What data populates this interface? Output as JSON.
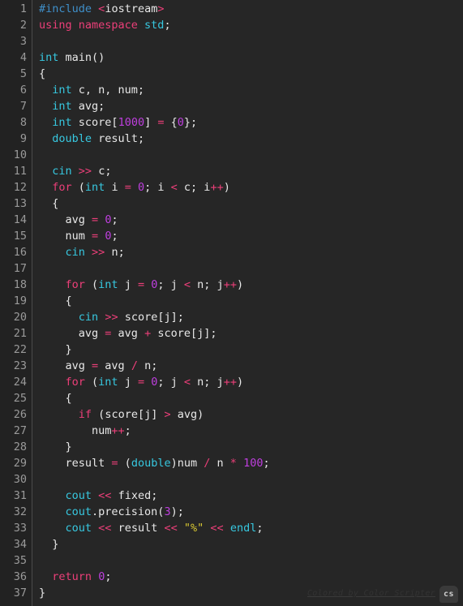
{
  "editor": {
    "theme_name": "dark",
    "language": "cpp",
    "total_lines": 37,
    "colors": {
      "background": "#262626",
      "gutter_background": "#222222",
      "gutter_border": "#4a4a4a",
      "line_number": "#9a9a9a",
      "default_text": "#e8e8e8",
      "preprocessor": "#3f8fc9",
      "keyword": "#ec3f79",
      "type": "#37c8e0",
      "number": "#bf3fdf",
      "operator": "#ec3f79",
      "string": "#d8c832"
    }
  },
  "line_numbers": [
    "1",
    "2",
    "3",
    "4",
    "5",
    "6",
    "7",
    "8",
    "9",
    "10",
    "11",
    "12",
    "13",
    "14",
    "15",
    "16",
    "17",
    "18",
    "19",
    "20",
    "21",
    "22",
    "23",
    "24",
    "25",
    "26",
    "27",
    "28",
    "29",
    "30",
    "31",
    "32",
    "33",
    "34",
    "35",
    "36",
    "37"
  ],
  "code_lines": [
    {
      "n": 1,
      "text": "#include <iostream>",
      "tokens": [
        {
          "t": "pre",
          "v": "#include"
        },
        {
          "t": "id",
          "v": " "
        },
        {
          "t": "op",
          "v": "<"
        },
        {
          "t": "id",
          "v": "iostream"
        },
        {
          "t": "op",
          "v": ">"
        }
      ]
    },
    {
      "n": 2,
      "text": "using namespace std;",
      "tokens": [
        {
          "t": "kw",
          "v": "using namespace "
        },
        {
          "t": "type",
          "v": "std"
        },
        {
          "t": "punc",
          "v": ";"
        }
      ]
    },
    {
      "n": 3,
      "text": "",
      "tokens": []
    },
    {
      "n": 4,
      "text": "int main()",
      "tokens": [
        {
          "t": "type",
          "v": "int"
        },
        {
          "t": "id",
          "v": " main()"
        }
      ]
    },
    {
      "n": 5,
      "text": "{",
      "tokens": [
        {
          "t": "punc",
          "v": "{"
        }
      ]
    },
    {
      "n": 6,
      "text": "  int c, n, num;",
      "tokens": [
        {
          "t": "id",
          "v": "  "
        },
        {
          "t": "type",
          "v": "int"
        },
        {
          "t": "id",
          "v": " c, n, num;"
        }
      ]
    },
    {
      "n": 7,
      "text": "  int avg;",
      "tokens": [
        {
          "t": "id",
          "v": "  "
        },
        {
          "t": "type",
          "v": "int"
        },
        {
          "t": "id",
          "v": " avg;"
        }
      ]
    },
    {
      "n": 8,
      "text": "  int score[1000] = {0};",
      "tokens": [
        {
          "t": "id",
          "v": "  "
        },
        {
          "t": "type",
          "v": "int"
        },
        {
          "t": "id",
          "v": " score["
        },
        {
          "t": "num",
          "v": "1000"
        },
        {
          "t": "punc",
          "v": "] "
        },
        {
          "t": "op",
          "v": "="
        },
        {
          "t": "punc",
          "v": " {"
        },
        {
          "t": "num",
          "v": "0"
        },
        {
          "t": "punc",
          "v": "};"
        }
      ]
    },
    {
      "n": 9,
      "text": "  double result;",
      "tokens": [
        {
          "t": "id",
          "v": "  "
        },
        {
          "t": "type",
          "v": "double"
        },
        {
          "t": "id",
          "v": " result;"
        }
      ]
    },
    {
      "n": 10,
      "text": "",
      "tokens": []
    },
    {
      "n": 11,
      "text": "  cin >> c;",
      "tokens": [
        {
          "t": "id",
          "v": "  "
        },
        {
          "t": "type",
          "v": "cin"
        },
        {
          "t": "id",
          "v": " "
        },
        {
          "t": "op",
          "v": ">>"
        },
        {
          "t": "id",
          "v": " c;"
        }
      ]
    },
    {
      "n": 12,
      "text": "  for (int i = 0; i < c; i++)",
      "tokens": [
        {
          "t": "id",
          "v": "  "
        },
        {
          "t": "kw",
          "v": "for"
        },
        {
          "t": "punc",
          "v": " ("
        },
        {
          "t": "type",
          "v": "int"
        },
        {
          "t": "id",
          "v": " i "
        },
        {
          "t": "op",
          "v": "="
        },
        {
          "t": "id",
          "v": " "
        },
        {
          "t": "num",
          "v": "0"
        },
        {
          "t": "punc",
          "v": "; "
        },
        {
          "t": "id",
          "v": "i "
        },
        {
          "t": "op",
          "v": "<"
        },
        {
          "t": "id",
          "v": " c; i"
        },
        {
          "t": "op",
          "v": "++"
        },
        {
          "t": "punc",
          "v": ")"
        }
      ]
    },
    {
      "n": 13,
      "text": "  {",
      "tokens": [
        {
          "t": "punc",
          "v": "  {"
        }
      ]
    },
    {
      "n": 14,
      "text": "    avg = 0;",
      "tokens": [
        {
          "t": "id",
          "v": "    avg "
        },
        {
          "t": "op",
          "v": "="
        },
        {
          "t": "id",
          "v": " "
        },
        {
          "t": "num",
          "v": "0"
        },
        {
          "t": "punc",
          "v": ";"
        }
      ]
    },
    {
      "n": 15,
      "text": "    num = 0;",
      "tokens": [
        {
          "t": "id",
          "v": "    num "
        },
        {
          "t": "op",
          "v": "="
        },
        {
          "t": "id",
          "v": " "
        },
        {
          "t": "num",
          "v": "0"
        },
        {
          "t": "punc",
          "v": ";"
        }
      ]
    },
    {
      "n": 16,
      "text": "    cin >> n;",
      "tokens": [
        {
          "t": "id",
          "v": "    "
        },
        {
          "t": "type",
          "v": "cin"
        },
        {
          "t": "id",
          "v": " "
        },
        {
          "t": "op",
          "v": ">>"
        },
        {
          "t": "id",
          "v": " n;"
        }
      ]
    },
    {
      "n": 17,
      "text": "",
      "tokens": []
    },
    {
      "n": 18,
      "text": "    for (int j = 0; j < n; j++)",
      "tokens": [
        {
          "t": "id",
          "v": "    "
        },
        {
          "t": "kw",
          "v": "for"
        },
        {
          "t": "punc",
          "v": " ("
        },
        {
          "t": "type",
          "v": "int"
        },
        {
          "t": "id",
          "v": " j "
        },
        {
          "t": "op",
          "v": "="
        },
        {
          "t": "id",
          "v": " "
        },
        {
          "t": "num",
          "v": "0"
        },
        {
          "t": "punc",
          "v": "; "
        },
        {
          "t": "id",
          "v": "j "
        },
        {
          "t": "op",
          "v": "<"
        },
        {
          "t": "id",
          "v": " n; j"
        },
        {
          "t": "op",
          "v": "++"
        },
        {
          "t": "punc",
          "v": ")"
        }
      ]
    },
    {
      "n": 19,
      "text": "    {",
      "tokens": [
        {
          "t": "punc",
          "v": "    {"
        }
      ]
    },
    {
      "n": 20,
      "text": "      cin >> score[j];",
      "tokens": [
        {
          "t": "id",
          "v": "      "
        },
        {
          "t": "type",
          "v": "cin"
        },
        {
          "t": "id",
          "v": " "
        },
        {
          "t": "op",
          "v": ">>"
        },
        {
          "t": "id",
          "v": " score[j];"
        }
      ]
    },
    {
      "n": 21,
      "text": "      avg = avg + score[j];",
      "tokens": [
        {
          "t": "id",
          "v": "      avg "
        },
        {
          "t": "op",
          "v": "="
        },
        {
          "t": "id",
          "v": " avg "
        },
        {
          "t": "op",
          "v": "+"
        },
        {
          "t": "id",
          "v": " score[j];"
        }
      ]
    },
    {
      "n": 22,
      "text": "    }",
      "tokens": [
        {
          "t": "punc",
          "v": "    }"
        }
      ]
    },
    {
      "n": 23,
      "text": "    avg = avg / n;",
      "tokens": [
        {
          "t": "id",
          "v": "    avg "
        },
        {
          "t": "op",
          "v": "="
        },
        {
          "t": "id",
          "v": " avg "
        },
        {
          "t": "op",
          "v": "/"
        },
        {
          "t": "id",
          "v": " n;"
        }
      ]
    },
    {
      "n": 24,
      "text": "    for (int j = 0; j < n; j++)",
      "tokens": [
        {
          "t": "id",
          "v": "    "
        },
        {
          "t": "kw",
          "v": "for"
        },
        {
          "t": "punc",
          "v": " ("
        },
        {
          "t": "type",
          "v": "int"
        },
        {
          "t": "id",
          "v": " j "
        },
        {
          "t": "op",
          "v": "="
        },
        {
          "t": "id",
          "v": " "
        },
        {
          "t": "num",
          "v": "0"
        },
        {
          "t": "punc",
          "v": "; "
        },
        {
          "t": "id",
          "v": "j "
        },
        {
          "t": "op",
          "v": "<"
        },
        {
          "t": "id",
          "v": " n; j"
        },
        {
          "t": "op",
          "v": "++"
        },
        {
          "t": "punc",
          "v": ")"
        }
      ]
    },
    {
      "n": 25,
      "text": "    {",
      "tokens": [
        {
          "t": "punc",
          "v": "    {"
        }
      ]
    },
    {
      "n": 26,
      "text": "      if (score[j] > avg)",
      "tokens": [
        {
          "t": "id",
          "v": "      "
        },
        {
          "t": "kw",
          "v": "if"
        },
        {
          "t": "punc",
          "v": " ("
        },
        {
          "t": "id",
          "v": "score[j] "
        },
        {
          "t": "op",
          "v": ">"
        },
        {
          "t": "id",
          "v": " avg)"
        }
      ]
    },
    {
      "n": 27,
      "text": "        num++;",
      "tokens": [
        {
          "t": "id",
          "v": "        num"
        },
        {
          "t": "op",
          "v": "++"
        },
        {
          "t": "punc",
          "v": ";"
        }
      ]
    },
    {
      "n": 28,
      "text": "    }",
      "tokens": [
        {
          "t": "punc",
          "v": "    }"
        }
      ]
    },
    {
      "n": 29,
      "text": "    result = (double)num / n * 100;",
      "tokens": [
        {
          "t": "id",
          "v": "    result "
        },
        {
          "t": "op",
          "v": "="
        },
        {
          "t": "punc",
          "v": " ("
        },
        {
          "t": "type",
          "v": "double"
        },
        {
          "t": "punc",
          "v": ")"
        },
        {
          "t": "id",
          "v": "num "
        },
        {
          "t": "op",
          "v": "/"
        },
        {
          "t": "id",
          "v": " n "
        },
        {
          "t": "op",
          "v": "*"
        },
        {
          "t": "id",
          "v": " "
        },
        {
          "t": "num",
          "v": "100"
        },
        {
          "t": "punc",
          "v": ";"
        }
      ]
    },
    {
      "n": 30,
      "text": "",
      "tokens": []
    },
    {
      "n": 31,
      "text": "    cout << fixed;",
      "tokens": [
        {
          "t": "id",
          "v": "    "
        },
        {
          "t": "type",
          "v": "cout"
        },
        {
          "t": "id",
          "v": " "
        },
        {
          "t": "op",
          "v": "<<"
        },
        {
          "t": "id",
          "v": " fixed;"
        }
      ]
    },
    {
      "n": 32,
      "text": "    cout.precision(3);",
      "tokens": [
        {
          "t": "id",
          "v": "    "
        },
        {
          "t": "type",
          "v": "cout"
        },
        {
          "t": "id",
          "v": ".precision("
        },
        {
          "t": "num",
          "v": "3"
        },
        {
          "t": "punc",
          "v": ");"
        }
      ]
    },
    {
      "n": 33,
      "text": "    cout << result << \"%\" << endl;",
      "tokens": [
        {
          "t": "id",
          "v": "    "
        },
        {
          "t": "type",
          "v": "cout"
        },
        {
          "t": "id",
          "v": " "
        },
        {
          "t": "op",
          "v": "<<"
        },
        {
          "t": "id",
          "v": " result "
        },
        {
          "t": "op",
          "v": "<<"
        },
        {
          "t": "id",
          "v": " "
        },
        {
          "t": "str",
          "v": "\"%\""
        },
        {
          "t": "id",
          "v": " "
        },
        {
          "t": "op",
          "v": "<<"
        },
        {
          "t": "id",
          "v": " "
        },
        {
          "t": "type",
          "v": "endl"
        },
        {
          "t": "punc",
          "v": ";"
        }
      ]
    },
    {
      "n": 34,
      "text": "  }",
      "tokens": [
        {
          "t": "punc",
          "v": "  }"
        }
      ]
    },
    {
      "n": 35,
      "text": "",
      "tokens": []
    },
    {
      "n": 36,
      "text": "  return 0;",
      "tokens": [
        {
          "t": "id",
          "v": "  "
        },
        {
          "t": "kw",
          "v": "return"
        },
        {
          "t": "id",
          "v": " "
        },
        {
          "t": "num",
          "v": "0"
        },
        {
          "t": "punc",
          "v": ";"
        }
      ]
    },
    {
      "n": 37,
      "text": "}",
      "tokens": [
        {
          "t": "punc",
          "v": "}"
        }
      ]
    }
  ],
  "watermark": {
    "text": "Colored by Color Scripter",
    "badge_label": "cs"
  }
}
